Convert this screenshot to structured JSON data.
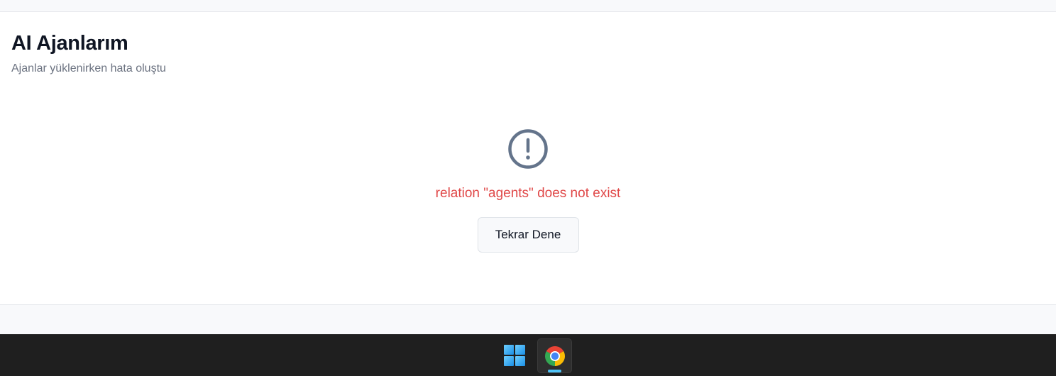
{
  "page": {
    "title": "AI Ajanlarım",
    "subtitle": "Ajanlar yüklenirken hata oluştu"
  },
  "error": {
    "icon": "alert-circle-icon",
    "message": "relation \"agents\" does not exist",
    "retry_label": "Tekrar Dene",
    "color": "#e04848"
  },
  "taskbar": {
    "items": [
      {
        "icon": "windows-start-icon"
      },
      {
        "icon": "chrome-icon",
        "active": true
      }
    ]
  }
}
